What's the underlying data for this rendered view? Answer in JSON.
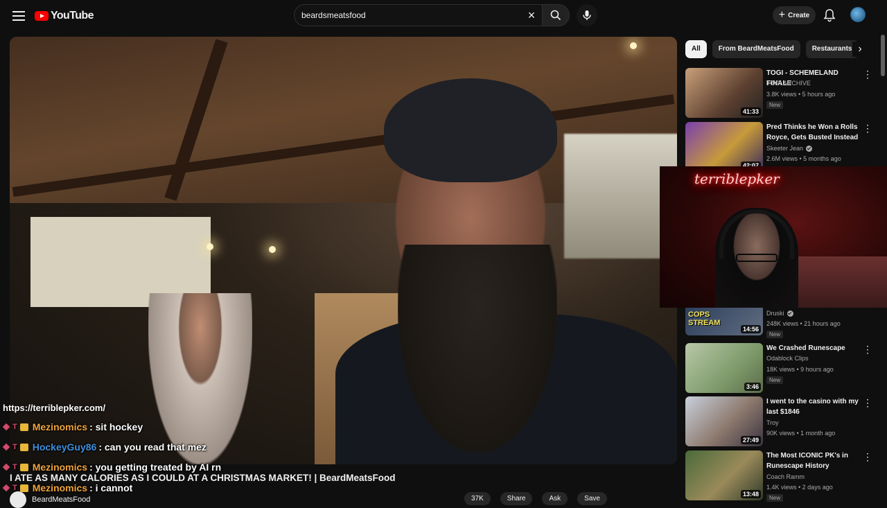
{
  "header": {
    "logo_text": "YouTube",
    "search_value": "beardsmeatsfood",
    "search_placeholder": "Search",
    "create_label": "Create"
  },
  "player": {
    "chat": {
      "url_line": "https://terriblepker.com/",
      "messages": [
        {
          "user": "Mezinomics",
          "text": ": sit hockey",
          "color": "#f0a43a"
        },
        {
          "user": "HockeyGuy86",
          "text": ": can you read that mez",
          "color": "#3d8fdc"
        },
        {
          "user": "Mezinomics",
          "text": ": you getting treated by AI rn",
          "color": "#f0a43a"
        },
        {
          "user": "Mezinomics",
          "text": ": i cannot",
          "color": "#f0a43a"
        }
      ]
    },
    "webcam_sign": "terriblepker"
  },
  "video": {
    "title": "I ATE AS MANY CALORIES AS I COULD AT A CHRISTMAS MARKET! | BeardMeatsFood",
    "channel": "BeardMeatsFood",
    "actions": [
      "37K",
      "Share",
      "Ask",
      "Save"
    ]
  },
  "sidebar": {
    "chips": [
      "All",
      "From BeardMeatsFood",
      "Restaurants"
    ],
    "recommendations": [
      {
        "title": "TOGI - SCHEMELAND FINALE",
        "channel": "TOGI ARCHIVE",
        "meta": "3.8K views • 5 hours ago",
        "badge": "New",
        "duration": "41:33",
        "verified": false
      },
      {
        "title": "Pred Thinks he Won a Rolls Royce, Gets Busted Instead",
        "channel": "Skeeter Jean",
        "meta": "2.6M views • 5 months ago",
        "badge": "",
        "duration": "42:07",
        "verified": true
      },
      {
        "title": "",
        "channel": "Druski",
        "meta": "248K views • 21 hours ago",
        "badge": "New",
        "duration": "14:56",
        "verified": true,
        "thumb_text": "COPS STREAM"
      },
      {
        "title": "We Crashed Runescape",
        "channel": "Odablock Clips",
        "meta": "18K views • 9 hours ago",
        "badge": "New",
        "duration": "3:46",
        "verified": false
      },
      {
        "title": "I went to the casino with my last $1846",
        "channel": "Troy",
        "meta": "90K views • 1 month ago",
        "badge": "",
        "duration": "27:49",
        "verified": false
      },
      {
        "title": "The Most ICONIC PK's in Runescape History",
        "channel": "Coach Ramm",
        "meta": "1.4K views • 2 days ago",
        "badge": "New",
        "duration": "13:48",
        "verified": false
      }
    ]
  },
  "colors": {
    "brand_red": "#ff0000",
    "background": "#0f0f0f",
    "chip_bg": "#272727"
  }
}
